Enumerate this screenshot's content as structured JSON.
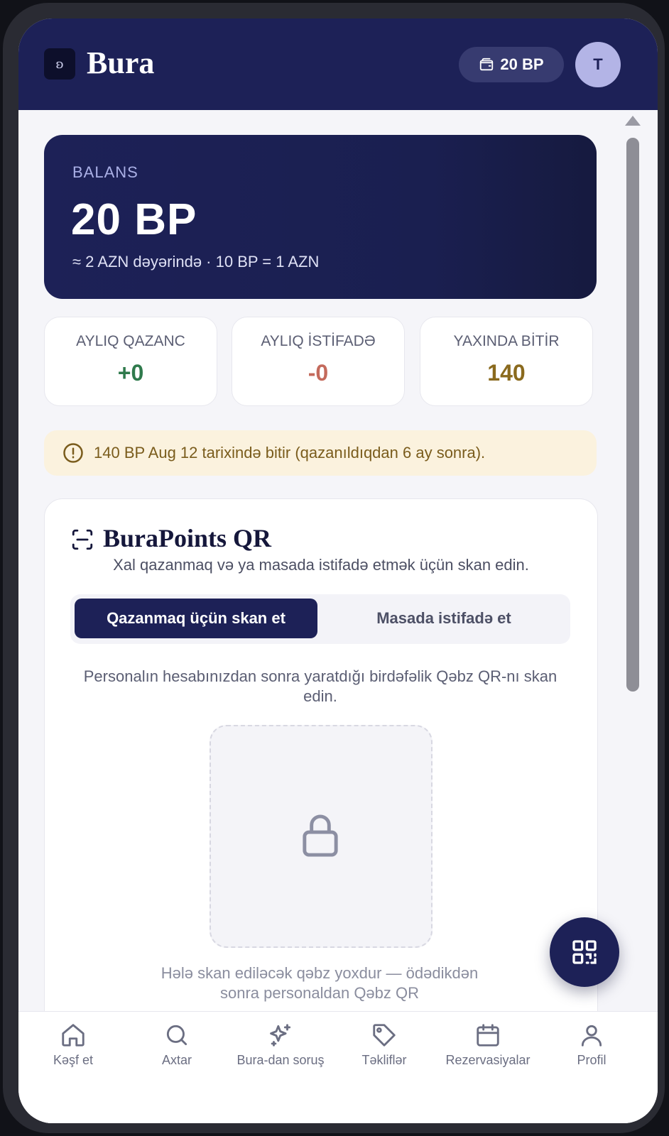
{
  "header": {
    "logo_glyph": "ʚ",
    "app_title": "Bura",
    "points_badge": "20 BP",
    "avatar_initial": "T"
  },
  "balance": {
    "label": "BALANS",
    "value": "20 BP",
    "subtitle": "≈ 2 AZN dəyərində · 10 BP = 1 AZN"
  },
  "stats": [
    {
      "label": "AYLIQ QAZANC",
      "value": "+0",
      "color": "#2f7a4c"
    },
    {
      "label": "AYLIQ İSTİFADƏ",
      "value": "-0",
      "color": "#c46a5c"
    },
    {
      "label": "YAXINDA BİTİR",
      "value": "140",
      "color": "#8a6a1e"
    }
  ],
  "warning": {
    "text": "140 BP Aug 12 tarixində bitir (qazanıldıqdan 6 ay sonra)."
  },
  "qr": {
    "title": "BuraPoints QR",
    "subtitle": "Xal qazanmaq və ya masada istifadə etmək üçün skan edin.",
    "tabs": [
      "Qazanmaq üçün skan et",
      "Masada istifadə et"
    ],
    "active_tab": 0,
    "instruction": "Personalın hesabınızdan sonra yaratdığı birdəfəlik Qəbz QR-nı skan edin.",
    "empty_text": "Hələ skan ediləcək qəbz yoxdur — ödədikdən sonra personaldan Qəbz QR"
  },
  "nav": [
    {
      "label": "Kəşf et",
      "icon": "home-icon"
    },
    {
      "label": "Axtar",
      "icon": "search-icon"
    },
    {
      "label": "Bura-dan soruş",
      "icon": "sparkles-icon"
    },
    {
      "label": "Təkliflər",
      "icon": "tag-icon"
    },
    {
      "label": "Rezervasiyalar",
      "icon": "calendar-icon"
    },
    {
      "label": "Profil",
      "icon": "user-icon"
    }
  ],
  "colors": {
    "brand": "#1d2157",
    "accent_soft": "#b3b4e6",
    "warning_bg": "#fbf2de"
  }
}
